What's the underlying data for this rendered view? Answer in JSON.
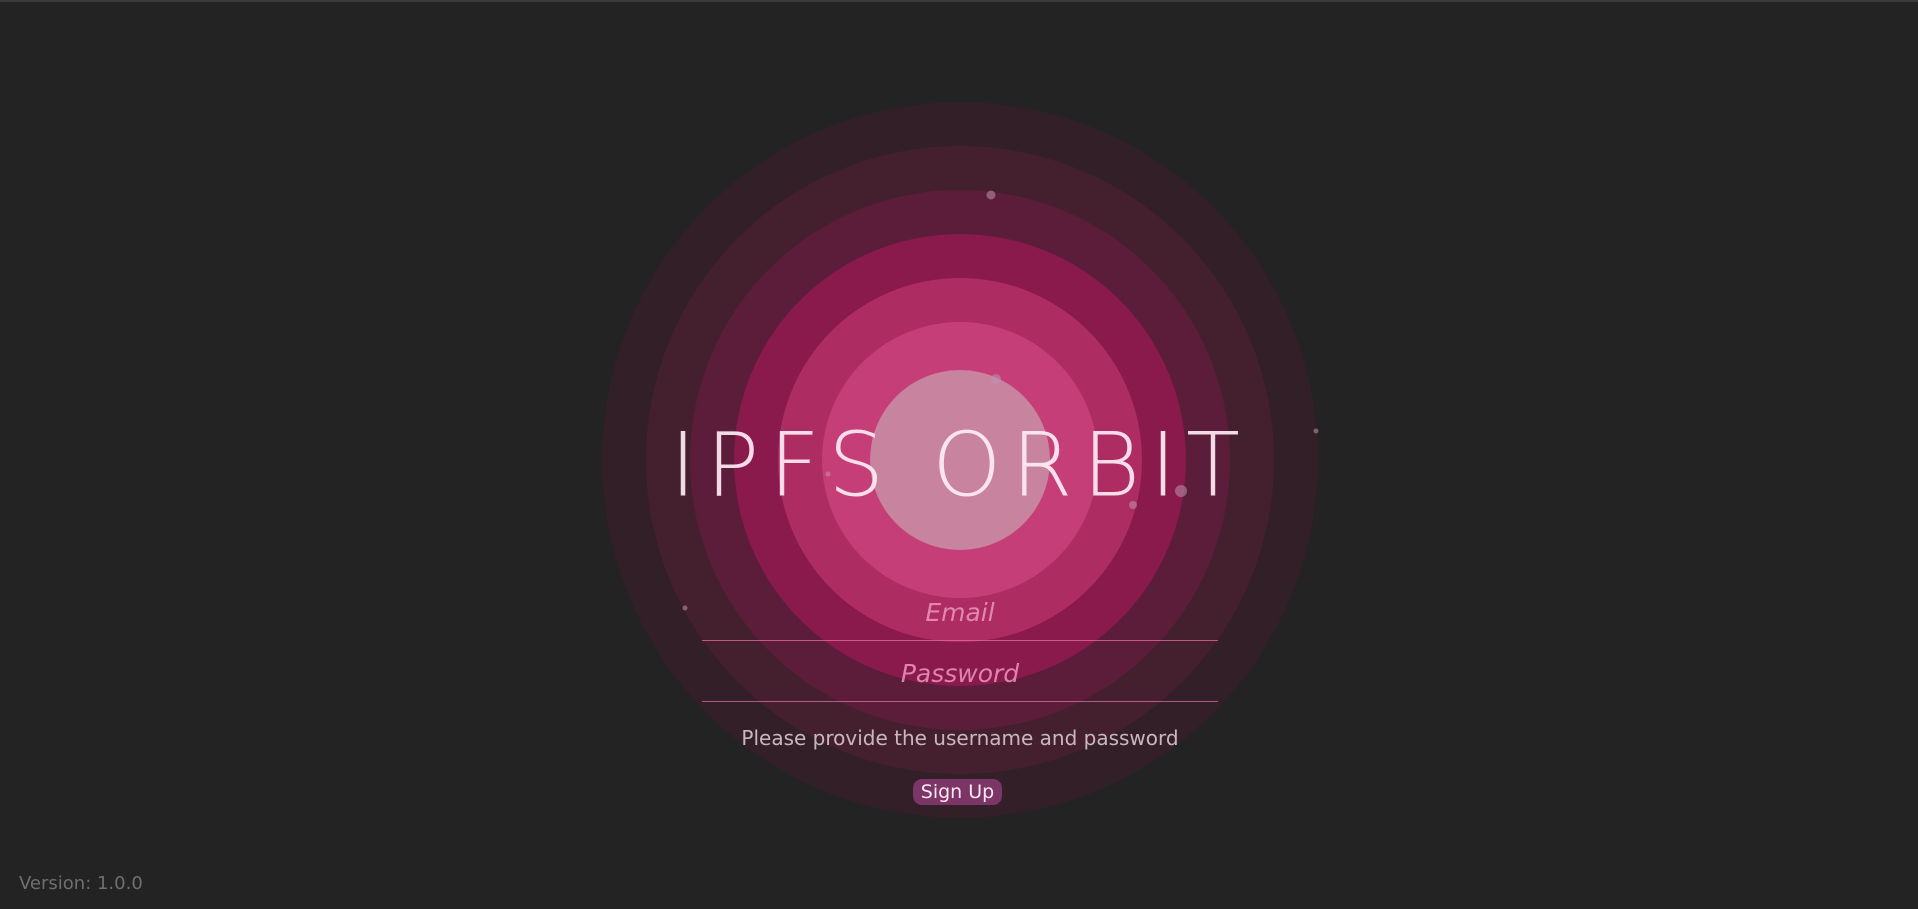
{
  "app": {
    "title": "IPFS ORBIT"
  },
  "login": {
    "email_placeholder": "Email",
    "password_placeholder": "Password",
    "message": "Please provide the username and password",
    "signup_label": "Sign Up"
  },
  "footer": {
    "version": "Version: 1.0.0"
  },
  "colors": {
    "background": "#232323",
    "ring_1": "#331f27",
    "ring_2": "#44202f",
    "ring_3": "#5c1d3a",
    "ring_4": "#8a1a4c",
    "ring_5": "#ad2d62",
    "ring_6": "#c63e78",
    "ring_7": "#c8849f",
    "button": "#7b3566"
  }
}
